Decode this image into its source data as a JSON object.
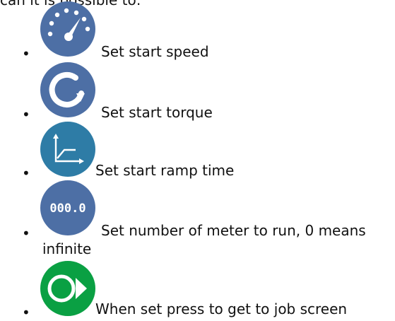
{
  "intro": "can it is possible to:",
  "items": [
    {
      "icon": "speedometer-icon",
      "label": "Set start speed"
    },
    {
      "icon": "rotate-arrow-icon",
      "label": "Set start torque"
    },
    {
      "icon": "ramp-graph-icon",
      "label": "Set start ramp time"
    },
    {
      "icon": "counter-icon",
      "icon_text": "000.0",
      "label": "Set number of meter to run, 0 means",
      "label_cont": "infinite"
    },
    {
      "icon": "play-start-icon",
      "label": "When set press to get to job screen"
    }
  ],
  "colors": {
    "icon_blue": "#4d6fa5",
    "icon_teal": "#2e7ca6",
    "icon_green": "#0aa043",
    "text": "#111111"
  }
}
